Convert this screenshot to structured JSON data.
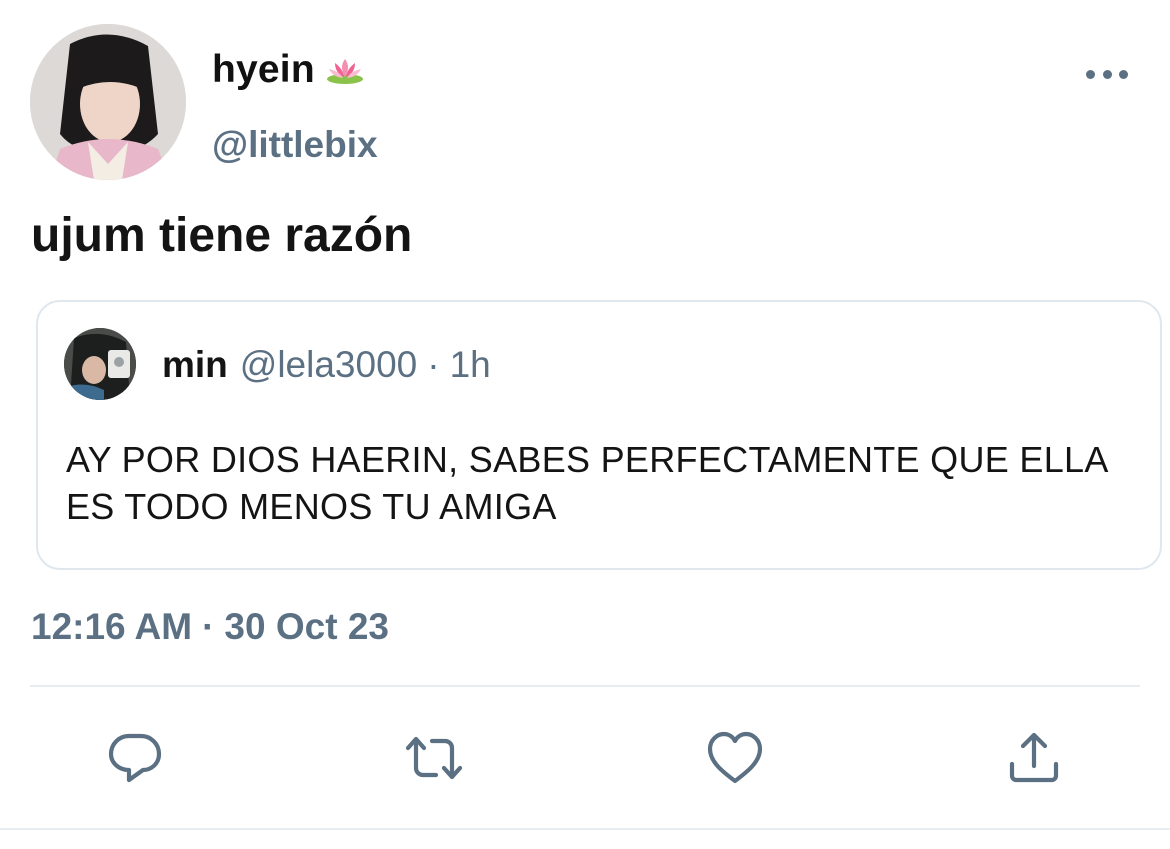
{
  "author": {
    "display_name": "hyein",
    "handle": "@littlebix",
    "name_emoji": "lotus-emoji"
  },
  "tweet": {
    "text": "ujum tiene razón",
    "time": "12:16 AM",
    "separator": "·",
    "date": "30 Oct 23"
  },
  "quoted": {
    "display_name": "min",
    "handle": "@lela3000",
    "separator": "·",
    "age": "1h",
    "text": "AY POR DIOS HAERIN, SABES PERFECTAMENTE QUE ELLA ES TODO MENOS TU AMIGA"
  },
  "icons": {
    "more": "more-dots-icon",
    "reply": "reply-icon",
    "retweet": "retweet-icon",
    "like": "heart-icon",
    "share": "share-icon"
  },
  "colors": {
    "secondary_text": "#5b7083",
    "primary_text": "#141414",
    "border": "#e1e8ed"
  }
}
